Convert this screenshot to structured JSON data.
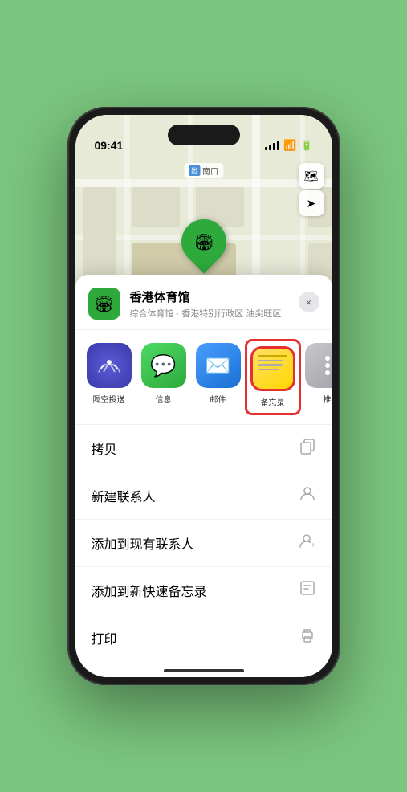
{
  "status_bar": {
    "time": "09:41",
    "location_arrow": "▶"
  },
  "map": {
    "label_prefix": "南口",
    "pin_label": "香港体育馆",
    "pin_emoji": "🏟"
  },
  "location_card": {
    "name": "香港体育馆",
    "subtitle": "综合体育馆 · 香港特别行政区 油尖旺区",
    "icon": "🏟",
    "close_label": "×"
  },
  "share_items": [
    {
      "id": "airdrop",
      "label": "隔空投送"
    },
    {
      "id": "messages",
      "label": "信息",
      "emoji": "💬"
    },
    {
      "id": "mail",
      "label": "邮件",
      "emoji": "✉️"
    },
    {
      "id": "notes",
      "label": "备忘录"
    },
    {
      "id": "more",
      "label": "推"
    }
  ],
  "actions": [
    {
      "label": "拷贝",
      "icon": "copy"
    },
    {
      "label": "新建联系人",
      "icon": "person-add"
    },
    {
      "label": "添加到现有联系人",
      "icon": "person-plus"
    },
    {
      "label": "添加到新快速备忘录",
      "icon": "note-new"
    },
    {
      "label": "打印",
      "icon": "print"
    }
  ],
  "colors": {
    "green": "#2eaa3c",
    "blue": "#4a9eff",
    "highlight_border": "#e63030"
  }
}
